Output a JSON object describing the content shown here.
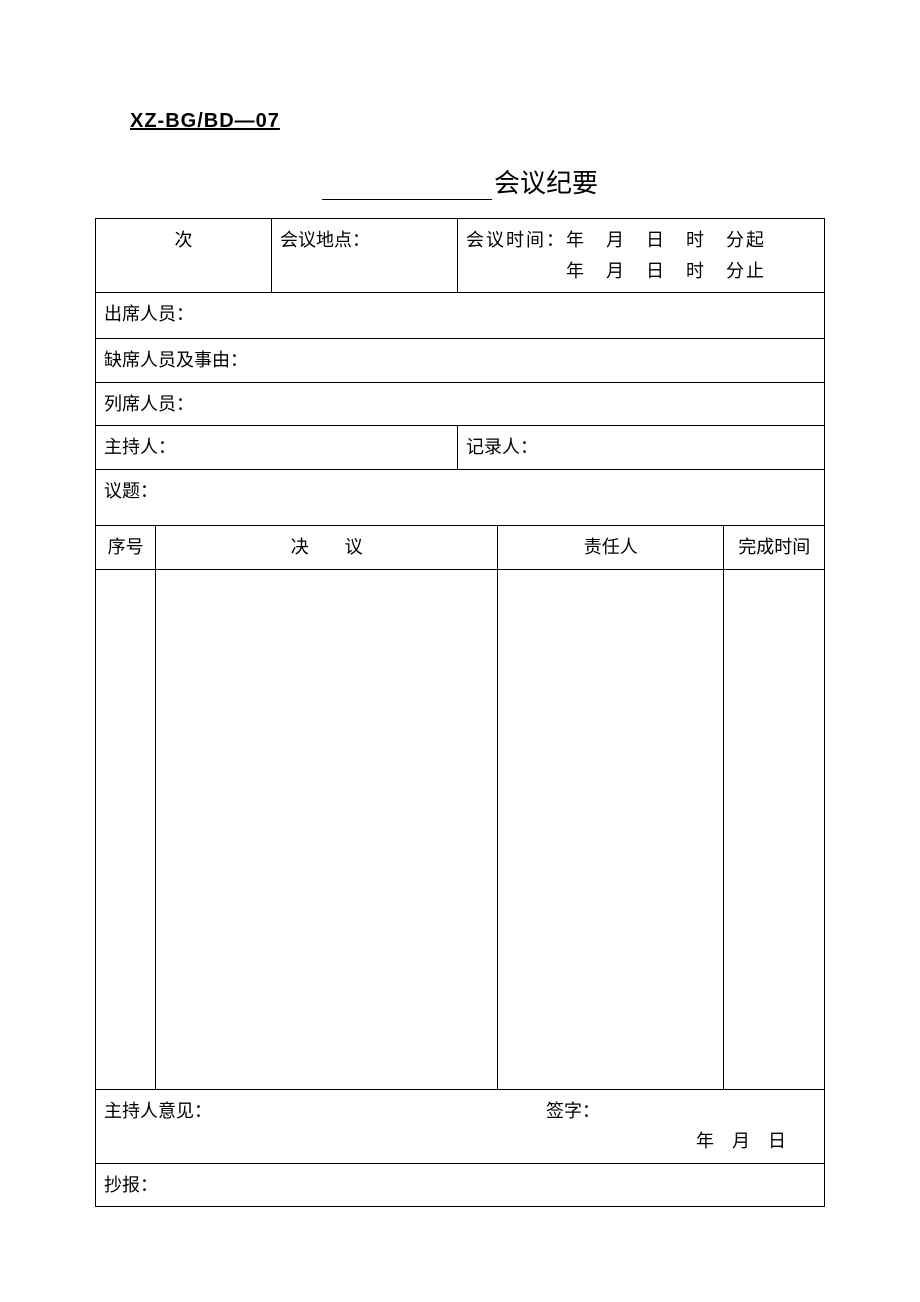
{
  "doc_code": "XZ-BG/BD—07",
  "title_suffix": "会议纪要",
  "row1": {
    "session_suffix": "次",
    "location_label": "会议地点：",
    "time_label": "会议时间：",
    "time_line1": "年　月　日　时　分起",
    "time_line2": "年　月　日　时　分止"
  },
  "labels": {
    "attendees": "出席人员：",
    "absentees": "缺席人员及事由：",
    "nonvoting": "列席人员：",
    "host": "主持人：",
    "recorder": "记录人：",
    "topic": "议题："
  },
  "columns": {
    "seq": "序号",
    "resolution": "决　　议",
    "owner": "责任人",
    "deadline": "完成时间"
  },
  "footer": {
    "host_opinion": "主持人意见：",
    "signature": "签字：",
    "date_line": "年　月　日",
    "cc": "抄报："
  }
}
